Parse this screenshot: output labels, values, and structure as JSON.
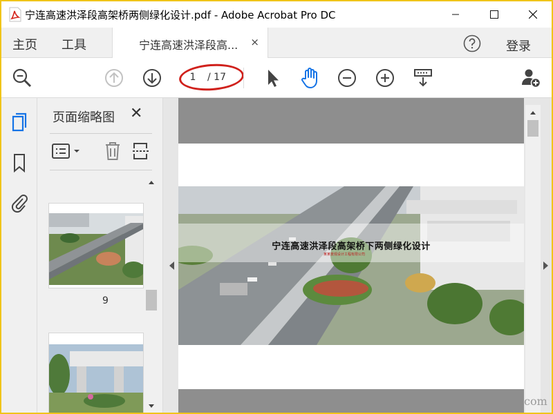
{
  "window": {
    "title": "宁连高速洪泽段高架桥两侧绿化设计.pdf - Adobe Acrobat Pro DC",
    "border_color": "#f0c419"
  },
  "nav": {
    "home": "主页",
    "tools": "工具",
    "doc_tab_label": "宁连高速洪泽段高...",
    "doc_tab_close": "×",
    "help_icon": "help-circle-icon",
    "login": "登录"
  },
  "toolbar": {
    "current_page": "1",
    "total_pages": "/ 17",
    "icons": [
      "search-zoom-icon",
      "page-up-icon",
      "page-down-icon",
      "select-arrow-icon",
      "hand-tool-icon",
      "zoom-out-icon",
      "zoom-in-icon",
      "fit-page-icon",
      "add-user-icon"
    ],
    "active_color": "#1473e6",
    "highlight_color": "#d0211c"
  },
  "left_rail": {
    "icons": [
      "pages-icon",
      "bookmark-icon",
      "attachment-icon"
    ]
  },
  "thumbnail_panel": {
    "title": "页面缩略图",
    "close": "✕",
    "thumbnails": [
      {
        "label": "9"
      },
      {
        "label": ""
      }
    ]
  },
  "document": {
    "cover_title": "宁连高速洪泽段高架桥下两侧绿化设计",
    "cover_company": "某某景观设计工程有限公司"
  },
  "watermark": "com"
}
